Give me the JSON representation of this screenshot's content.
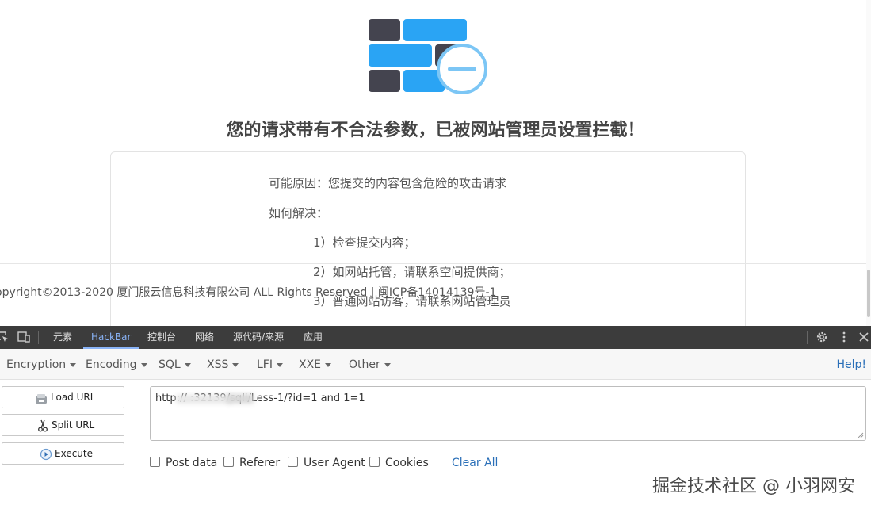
{
  "block_page": {
    "title": "您的请求带有不合法参数，已被网站管理员设置拦截！",
    "reason_label": "可能原因：您提交的内容包含危险的攻击请求",
    "solve_label": "如何解决：",
    "steps": [
      "1）检查提交内容；",
      "2）如网站托管，请联系空间提供商；",
      "3）普通网站访客，请联系网站管理员"
    ],
    "copyright": "opyright©2013-2020 厦门服云信息科技有限公司 ALL Rights Reserved | 闽ICP备14014139号-1",
    "colors": {
      "dark_brick": "#44444f",
      "blue_brick": "#2aa4f4",
      "circle": "#7cc6f5"
    }
  },
  "devtools": {
    "tabs": [
      "元素",
      "HackBar",
      "控制台",
      "网络",
      "源代码/来源",
      "应用"
    ],
    "active_tab": "HackBar",
    "accent": "#8ab4f8"
  },
  "hackbar": {
    "menus": [
      "Encryption",
      "Encoding",
      "SQL",
      "XSS",
      "LFI",
      "XXE",
      "Other"
    ],
    "help": "Help!",
    "buttons": {
      "load_url": "Load URL",
      "split_url": "Split URL",
      "execute": "Execute"
    },
    "url_value": "http://           :32139/sqli/Less-1/?id=1 and 1=1",
    "options": [
      "Post data",
      "Referer",
      "User Agent",
      "Cookies"
    ],
    "clear_all": "Clear All"
  },
  "watermark": "掘金技术社区 @ 小羽网安"
}
